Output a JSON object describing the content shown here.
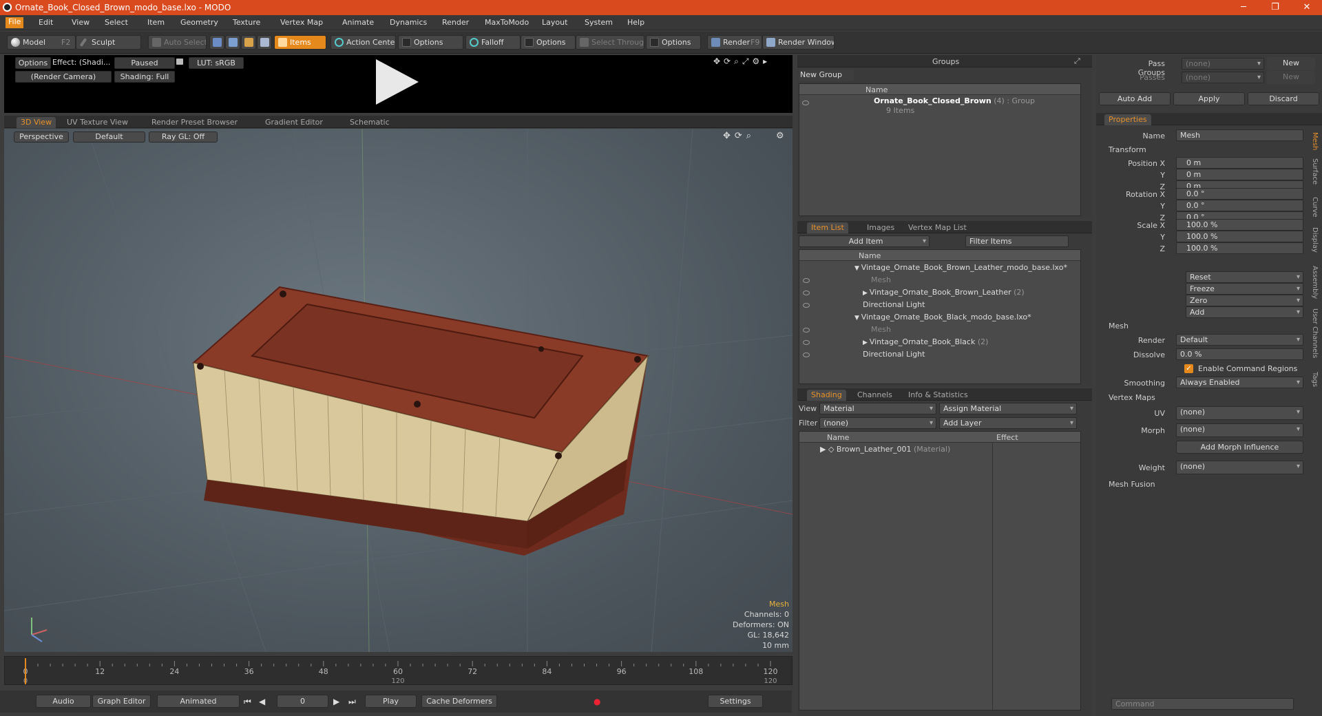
{
  "titlebar": {
    "title": "Ornate_Book_Closed_Brown_modo_base.lxo - MODO"
  },
  "menu": [
    "File",
    "Edit",
    "View",
    "Select",
    "Item",
    "Geometry",
    "Texture",
    "Vertex Map",
    "Animate",
    "Dynamics",
    "Render",
    "MaxToModo",
    "Layout",
    "System",
    "Help"
  ],
  "toolbar": {
    "model": "Model",
    "model_key": "F2",
    "sculpt": "Sculpt",
    "auto_select": "Auto Select",
    "items": "Items",
    "action_center": "Action Center",
    "options": "Options",
    "falloff": "Falloff",
    "select_through": "Select Through",
    "render": "Render",
    "render_key": "F9",
    "render_window": "Render Window"
  },
  "preview": {
    "options": "Options",
    "effect": "Effect: (Shadi...",
    "paused": "Paused",
    "lut": "LUT: sRGB",
    "camera": "(Render Camera)",
    "shading": "Shading: Full"
  },
  "viewport_tabs": [
    "3D View",
    "UV Texture View",
    "Render Preset Browser",
    "Gradient Editor",
    "Schematic"
  ],
  "viewport": {
    "perspective": "Perspective",
    "default": "Default",
    "raygl": "Ray GL: Off",
    "info": {
      "type": "Mesh",
      "channels": "Channels: 0",
      "deformers": "Deformers: ON",
      "gl": "GL: 18,642",
      "scale": "10 mm"
    }
  },
  "timeline": {
    "ticks": [
      "0",
      "12",
      "24",
      "36",
      "48",
      "60",
      "72",
      "84",
      "96",
      "108",
      "120"
    ],
    "bottom": [
      "0",
      "120",
      "120"
    ]
  },
  "bottombar": {
    "audio": "Audio",
    "graph_editor": "Graph Editor",
    "animated": "Animated",
    "frame": "0",
    "play": "Play",
    "cache": "Cache Deformers",
    "settings": "Settings"
  },
  "groups": {
    "title": "Groups",
    "new_group": "New Group",
    "col_name": "Name",
    "group_name": "Ornate_Book_Closed_Brown",
    "group_count": "(4)",
    "group_type": ": Group",
    "group_items": "9 Items"
  },
  "itemlist": {
    "tabs": [
      "Item List",
      "Images",
      "Vertex Map List"
    ],
    "add_item": "Add Item",
    "filter": "Filter Items",
    "col_name": "Name",
    "rows": [
      {
        "label": "Vintage_Ornate_Book_Brown_Leather_modo_base.lxo*",
        "indent": 0,
        "dim": false,
        "arrow": "▼",
        "eye": false
      },
      {
        "label": "Mesh",
        "indent": 2,
        "dim": true,
        "arrow": "",
        "eye": true
      },
      {
        "label": "Vintage_Ornate_Book_Brown_Leather",
        "suffix": "(2)",
        "indent": 1,
        "dim": false,
        "arrow": "▶",
        "eye": true
      },
      {
        "label": "Directional Light",
        "indent": 1,
        "dim": false,
        "arrow": "",
        "eye": true
      },
      {
        "label": "Vintage_Ornate_Book_Black_modo_base.lxo*",
        "indent": 0,
        "dim": false,
        "arrow": "▼",
        "eye": false
      },
      {
        "label": "Mesh",
        "indent": 2,
        "dim": true,
        "arrow": "",
        "eye": true
      },
      {
        "label": "Vintage_Ornate_Book_Black",
        "suffix": "(2)",
        "indent": 1,
        "dim": false,
        "arrow": "▶",
        "eye": true
      },
      {
        "label": "Directional Light",
        "indent": 1,
        "dim": false,
        "arrow": "",
        "eye": true
      }
    ]
  },
  "shading": {
    "tabs": [
      "Shading",
      "Channels",
      "Info & Statistics"
    ],
    "view_lbl": "View",
    "view": "Material",
    "assign": "Assign Material",
    "filter_lbl": "Filter",
    "filter": "(none)",
    "add_layer": "Add Layer",
    "col_name": "Name",
    "col_effect": "Effect",
    "row": "Brown_Leather_001",
    "row_type": "(Material)"
  },
  "right": {
    "pass_groups": "Pass Groups",
    "passes": "Passes",
    "none": "(none)",
    "new": "New",
    "auto_add": "Auto Add",
    "apply": "Apply",
    "discard": "Discard",
    "properties": "Properties",
    "name_lbl": "Name",
    "name": "Mesh",
    "transform": "Transform",
    "position_lbl": "Position X",
    "rotation_lbl": "Rotation X",
    "scale_lbl": "Scale X",
    "y": "Y",
    "z": "Z",
    "pos": [
      "0 m",
      "0 m",
      "0 m"
    ],
    "rot": [
      "0.0 °",
      "0.0 °",
      "0.0 °"
    ],
    "scl": [
      "100.0 %",
      "100.0 %",
      "100.0 %"
    ],
    "reset": "Reset",
    "freeze": "Freeze",
    "zero": "Zero",
    "add": "Add",
    "mesh": "Mesh",
    "render_lbl": "Render",
    "render": "Default",
    "dissolve_lbl": "Dissolve",
    "dissolve": "0.0 %",
    "ecr": "Enable Command Regions",
    "smoothing_lbl": "Smoothing",
    "smoothing": "Always Enabled",
    "vertex_maps": "Vertex Maps",
    "uv_lbl": "UV",
    "morph_lbl": "Morph",
    "add_morph": "Add Morph Influence",
    "weight_lbl": "Weight",
    "mesh_fusion": "Mesh Fusion",
    "side_tabs": [
      "Mesh",
      "Surface",
      "Curve",
      "Display",
      "Assembly",
      "User Channels",
      "Tags"
    ],
    "command": "Command"
  }
}
